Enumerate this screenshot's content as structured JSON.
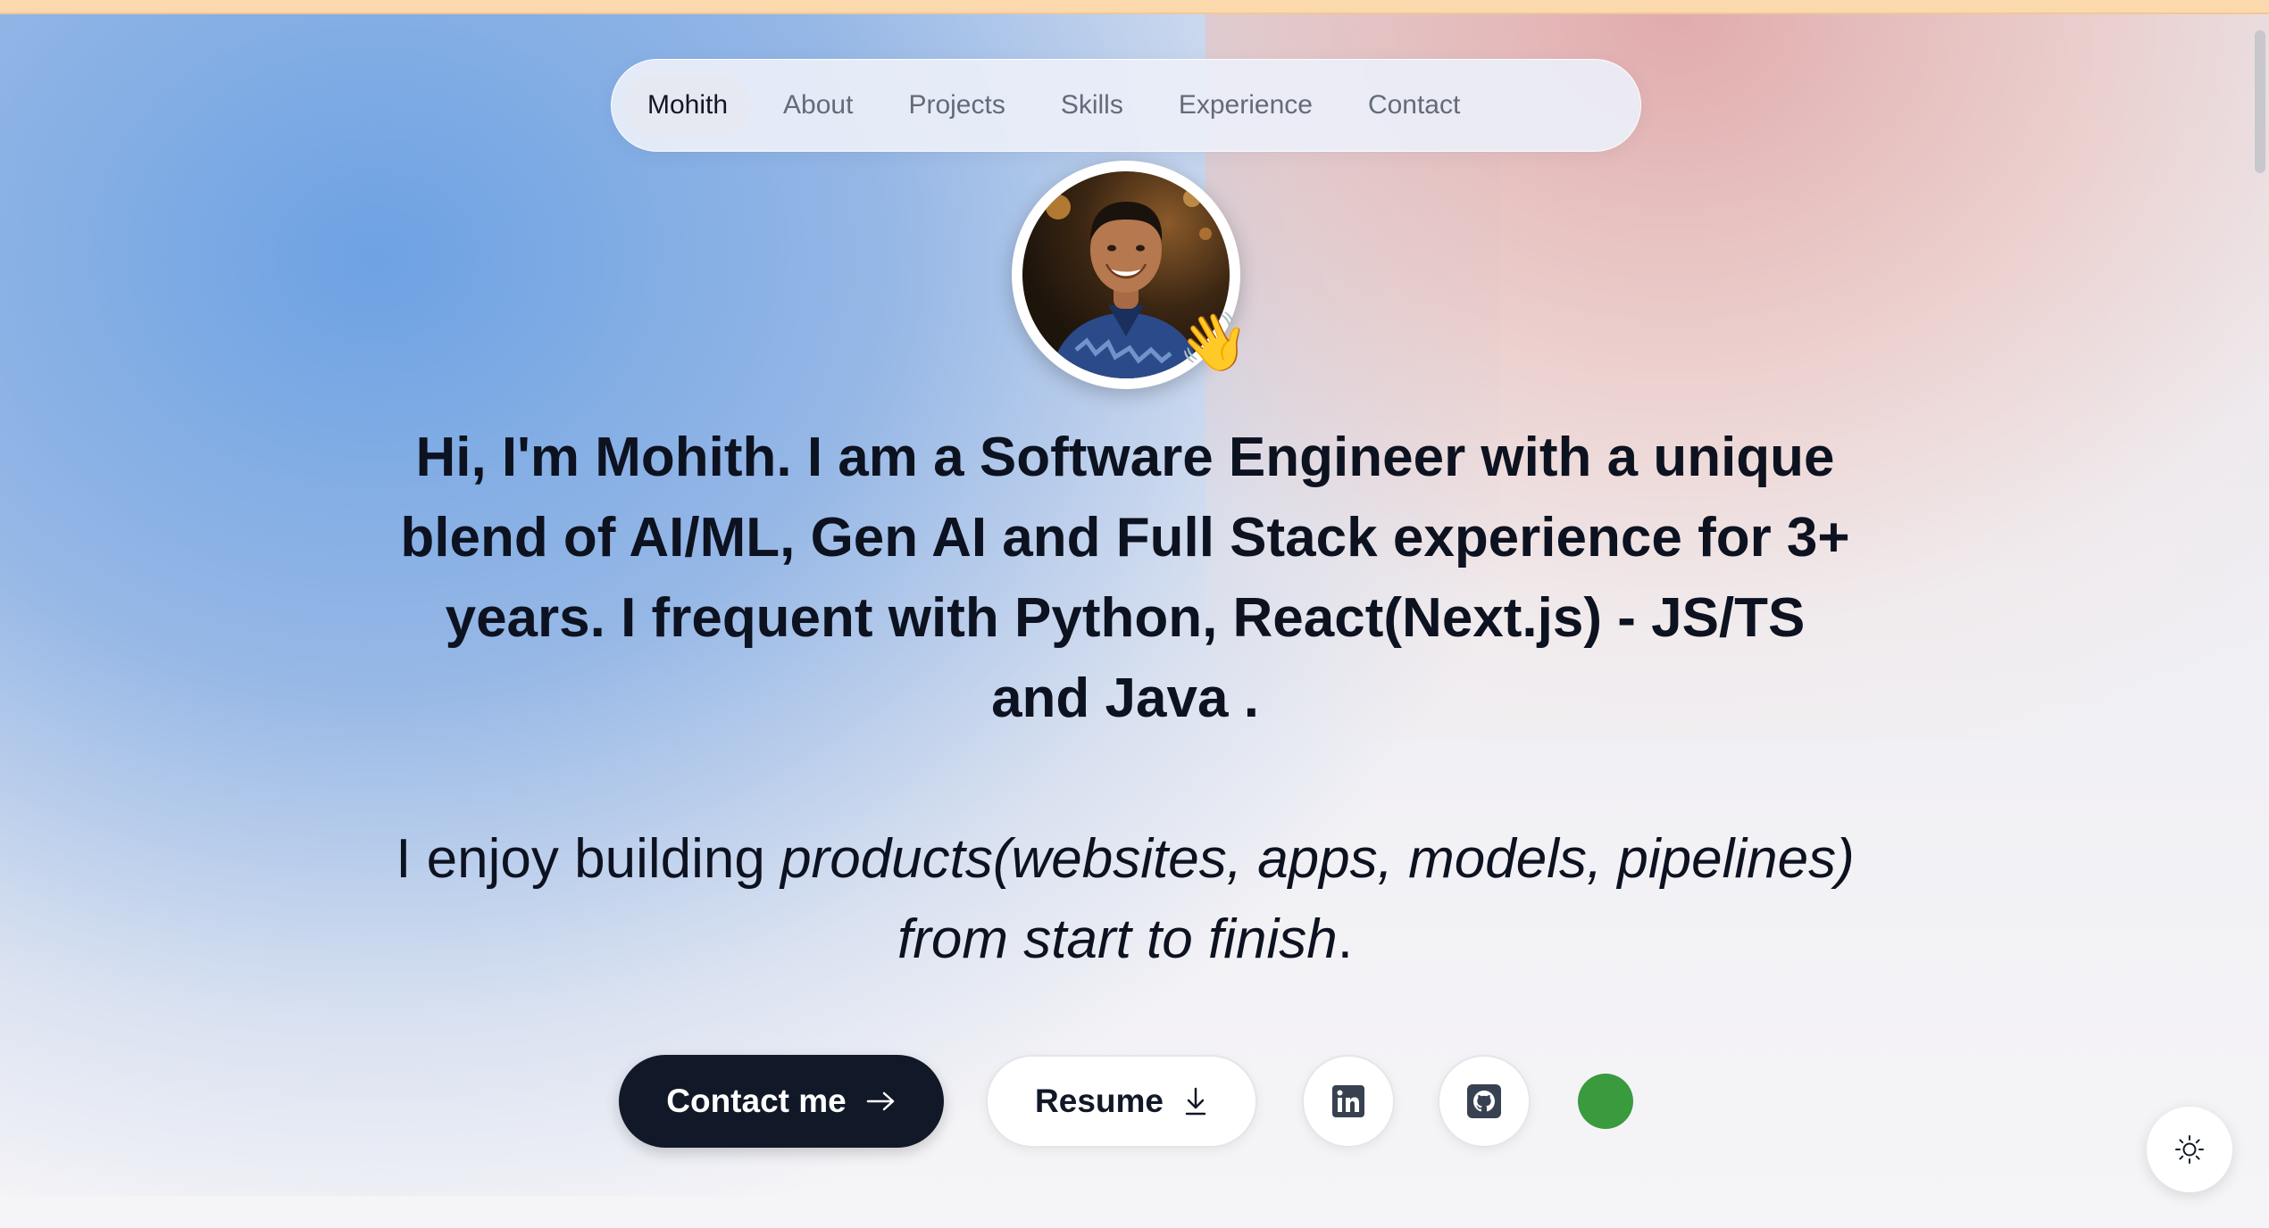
{
  "nav": {
    "items": [
      {
        "label": "Mohith",
        "active": true
      },
      {
        "label": "About"
      },
      {
        "label": "Projects"
      },
      {
        "label": "Skills"
      },
      {
        "label": "Experience"
      },
      {
        "label": "Contact"
      }
    ]
  },
  "hero": {
    "avatar_icon": "profile-photo",
    "wave_emoji": "👋",
    "headline": {
      "p1": "Hi, I'm ",
      "name": "Mohith.",
      "p2": " I am a Software Engineer with a unique blend of ",
      "domains": "AI/ML, Gen AI and Full Stack",
      "p3": " experience ",
      "years": "for 3+ years",
      "p4": ". I frequent with ",
      "stack": "Python, React(Next.js) - JS/TS and Java",
      "p5": " ."
    },
    "sub": {
      "p1": "I enjoy building ",
      "italic": "products(websites, apps, models, pipelines) from start to finish",
      "p2": "."
    }
  },
  "actions": {
    "contact_label": "Contact me",
    "contact_icon": "arrow-right-icon",
    "resume_label": "Resume",
    "resume_icon": "download-icon",
    "linkedin_icon": "linkedin-icon",
    "github_icon": "github-icon",
    "status_color": "#3a9a3e"
  },
  "theme": {
    "icon": "sun-icon"
  },
  "colors": {
    "primary": "#111827",
    "top_bar": "#fbd9ad"
  }
}
